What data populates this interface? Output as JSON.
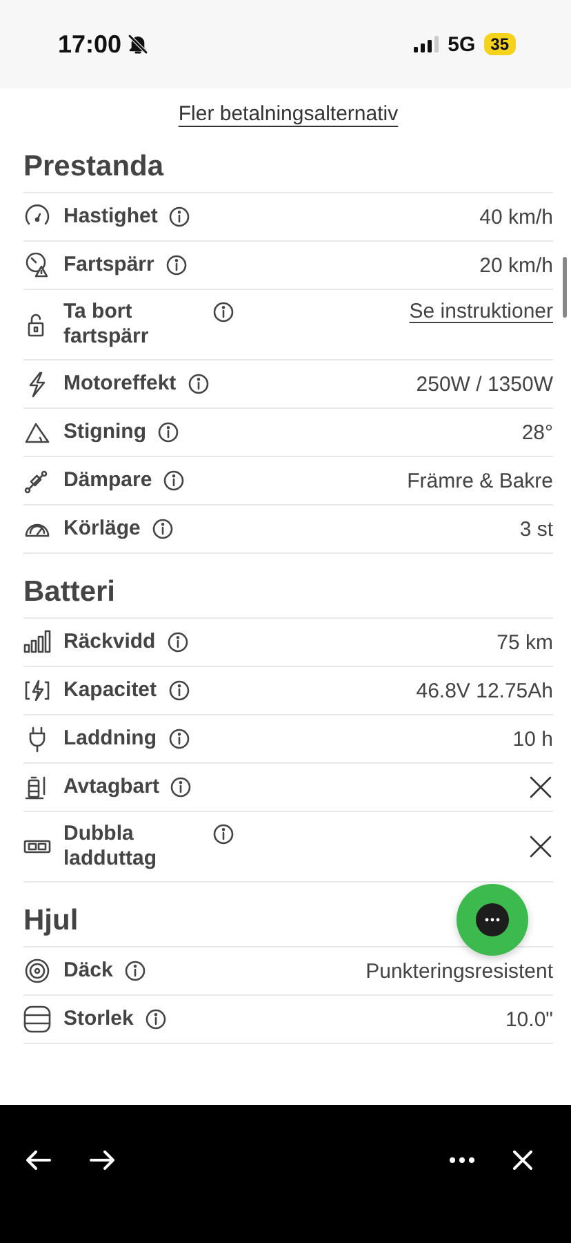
{
  "status_bar": {
    "time": "17:00",
    "network": "5G",
    "battery": "35"
  },
  "payment_link": "Fler betalningsalternativ",
  "sections": [
    {
      "title": "Prestanda",
      "rows": [
        {
          "label": "Hastighet",
          "kind": "text",
          "value": "40 km/h"
        },
        {
          "label": "Fartspärr",
          "kind": "text",
          "value": "20 km/h"
        },
        {
          "label": "Ta bort fartspärr",
          "kind": "link",
          "value": "Se instruktioner"
        },
        {
          "label": "Motoreffekt",
          "kind": "text",
          "value": "250W / 1350W"
        },
        {
          "label": "Stigning",
          "kind": "text",
          "value": "28°"
        },
        {
          "label": "Dämpare",
          "kind": "text",
          "value": "Främre & Bakre"
        },
        {
          "label": "Körläge",
          "kind": "text",
          "value": "3 st"
        }
      ]
    },
    {
      "title": "Batteri",
      "rows": [
        {
          "label": "Räckvidd",
          "kind": "text",
          "value": "75 km"
        },
        {
          "label": "Kapacitet",
          "kind": "text",
          "value": "46.8V 12.75Ah"
        },
        {
          "label": "Laddning",
          "kind": "text",
          "value": "10 h"
        },
        {
          "label": "Avtagbart",
          "kind": "no"
        },
        {
          "label": "Dubbla ladduttag",
          "kind": "no"
        }
      ]
    },
    {
      "title": "Hjul",
      "rows": [
        {
          "label": "Däck",
          "kind": "text",
          "value": "Punkteringsresistent"
        },
        {
          "label": "Storlek",
          "kind": "text",
          "value": "10.0\""
        }
      ]
    }
  ]
}
